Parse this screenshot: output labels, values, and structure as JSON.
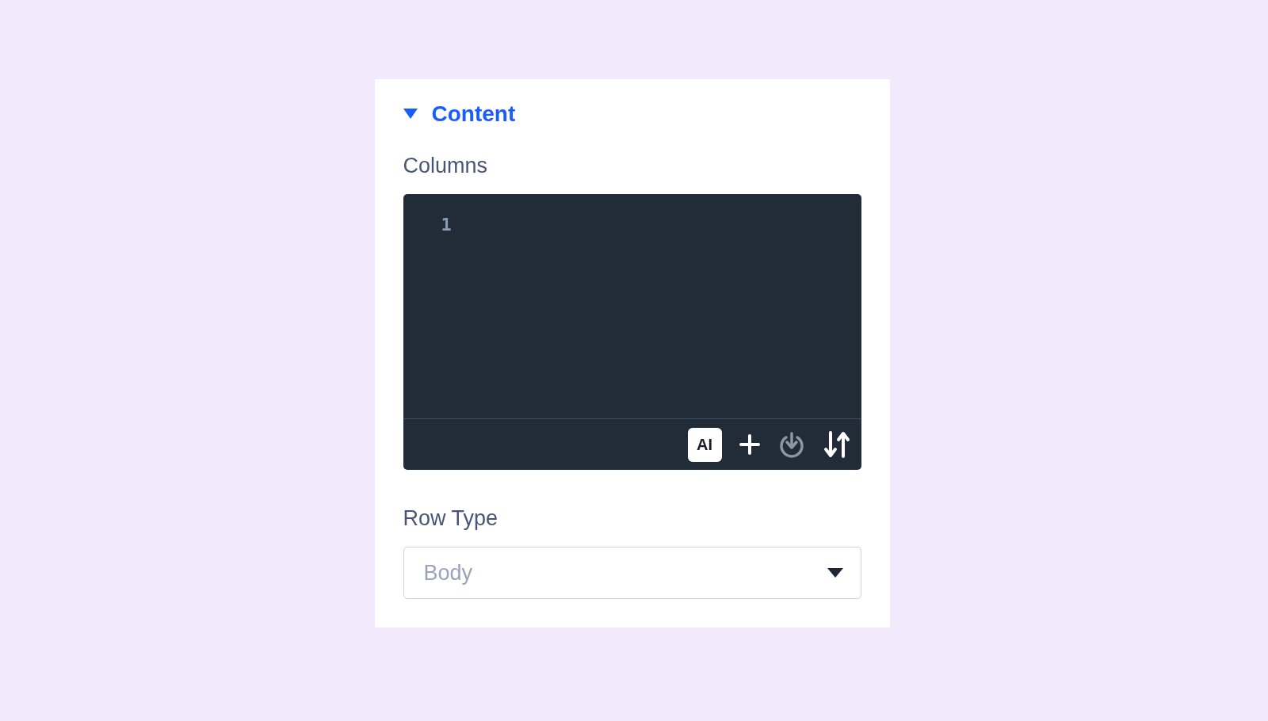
{
  "section": {
    "title": "Content",
    "expanded": true
  },
  "fields": [
    {
      "kind": "code",
      "label": "Columns",
      "line_numbers": [
        "1"
      ],
      "toolbar": [
        {
          "kind": "ai",
          "label": "AI"
        },
        {
          "kind": "add"
        },
        {
          "kind": "import"
        },
        {
          "kind": "sort"
        }
      ]
    },
    {
      "kind": "select",
      "label": "Row Type",
      "placeholder": "Body"
    }
  ]
}
